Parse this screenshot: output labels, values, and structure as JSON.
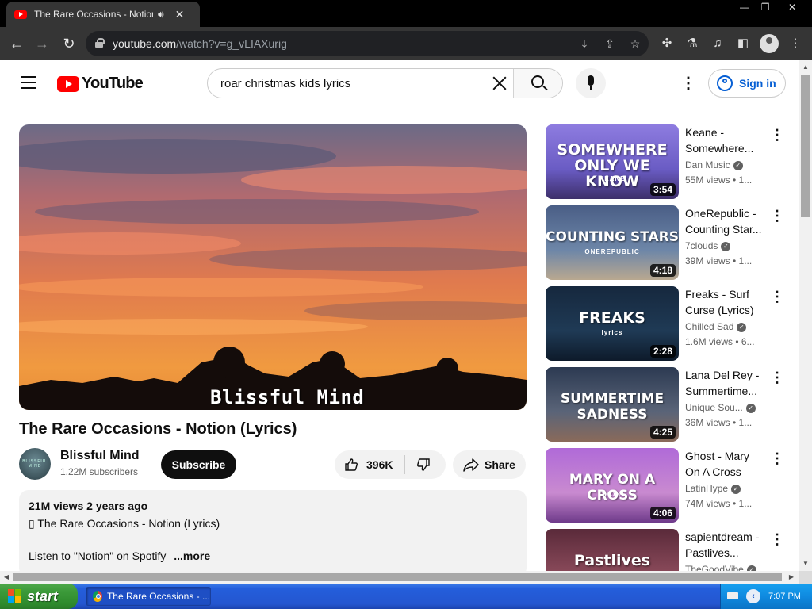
{
  "browser": {
    "tab_title": "The Rare Occasions - Notion (L",
    "url_host": "youtube.com",
    "url_path": "/watch?v=g_vLIAXurig",
    "window_controls": {
      "minimize": "—",
      "restore": "❐",
      "close": "✕"
    }
  },
  "youtube": {
    "logo_text": "YouTube",
    "search_value": "roar christmas kids lyrics",
    "signin_label": "Sign in"
  },
  "video": {
    "watermark": "Blissful Mind",
    "title": "The Rare Occasions - Notion (Lyrics)",
    "channel": "Blissful Mind",
    "avatar_text": "BLISSFUL MIND",
    "subscribers": "1.22M subscribers",
    "subscribe_label": "Subscribe",
    "likes": "396K",
    "share_label": "Share",
    "description": {
      "meta": "21M views  2 years ago",
      "line1": "▯ The Rare Occasions - Notion (Lyrics)",
      "line2_start": "Listen to \"Notion\" on Spotify",
      "line2_fade": " ",
      "more": "...more"
    }
  },
  "recommendations": [
    {
      "title": "Keane - Somewhere...",
      "channel": "Dan Music",
      "views": "55M views  • 1...",
      "duration": "3:54",
      "thumb_line1": "SOMEWHERE",
      "thumb_line2": "ONLY WE KNOW",
      "thumb_sub": "KEANE",
      "colors": [
        "#8e7ce0",
        "#6a5cc4",
        "#3d2f6a"
      ]
    },
    {
      "title": "OneRepublic - Counting Star...",
      "channel": "7clouds",
      "views": "39M views  • 1...",
      "duration": "4:18",
      "thumb_line1": "COUNTING STARS",
      "thumb_line2": "",
      "thumb_sub": "ONEREPUBLIC",
      "colors": [
        "#4a5e86",
        "#6d86a8",
        "#b9a890"
      ]
    },
    {
      "title": "Freaks - Surf Curse (Lyrics)",
      "channel": "Chilled Sad",
      "views": "1.6M views  • 6...",
      "duration": "2:28",
      "thumb_line1": "FREAKS",
      "thumb_line2": "",
      "thumb_sub": "lyrics",
      "colors": [
        "#16283e",
        "#1f3a55",
        "#0d1a2a"
      ]
    },
    {
      "title": "Lana Del Rey - Summertime...",
      "channel": "Unique Sou...",
      "views": "36M views  • 1...",
      "duration": "4:25",
      "thumb_line1": "SUMMERTIME SADNESS",
      "thumb_line2": "",
      "thumb_sub": "",
      "colors": [
        "#2c3a52",
        "#5a6478",
        "#8a6a5a"
      ]
    },
    {
      "title": "Ghost - Mary On A Cross",
      "channel": "LatinHype",
      "views": "74M views  • 1...",
      "duration": "4:06",
      "thumb_line1": "MARY ON A CROSS",
      "thumb_line2": "",
      "thumb_sub": "GHOST",
      "colors": [
        "#b06ad8",
        "#c98ad0",
        "#6e3a8a"
      ]
    },
    {
      "title": "sapientdream - Pastlives...",
      "channel": "TheGoodVibe",
      "views": "",
      "duration": "",
      "thumb_line1": "Pastlives",
      "thumb_line2": "",
      "thumb_sub": "",
      "colors": [
        "#5a2a3a",
        "#8a4a5a",
        "#3a1a28"
      ]
    }
  ],
  "taskbar": {
    "start_label": "start",
    "task_label": "The Rare Occasions - ...",
    "clock": "7:07 PM"
  }
}
